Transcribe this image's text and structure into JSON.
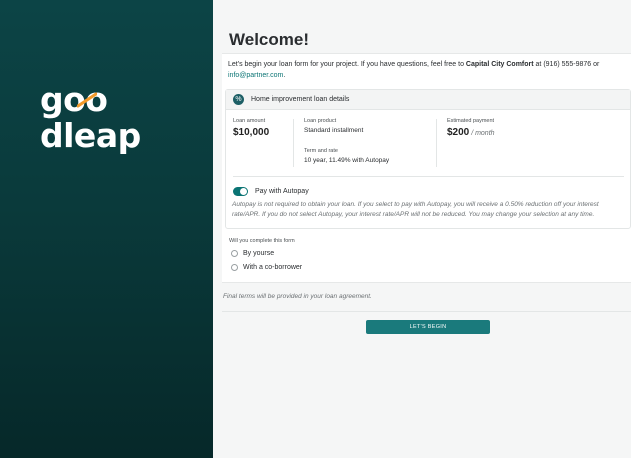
{
  "brand": {
    "logo_text_before": "g",
    "logo_text_oo": "oo",
    "logo_text_after": "dleap",
    "logo_name": "goodleap",
    "accent_color": "#f39a2a"
  },
  "main": {
    "title": "Welcome!",
    "intro": {
      "part1": "Let's begin your loan form for your project. If you have questions, feel free to ",
      "partner": "Capital City Comfort",
      "part2": " at (916) 555-9876 or ",
      "email": "info@partner.com",
      "part3": "."
    },
    "loan": {
      "header": "Home improvement loan details",
      "amount_label": "Loan amount",
      "amount_value": "$10,000",
      "product_label": "Loan product",
      "product_value": "Standard installment",
      "term_label": "Term and rate",
      "term_value": "10 year, 11.49% with Autopay",
      "payment_label": "Estimated payment",
      "payment_value": "$200",
      "payment_unit": " / month",
      "autopay_label": "Pay with Autopay",
      "autopay_enabled": true,
      "autopay_note": "Autopay is not required to obtain your loan. If you select to pay with Autopay, you will receive a 0.50% reduction off your interest rate/APR. If you do not select Autopay, your interest rate/APR will not be reduced. You may change your selection at any time."
    },
    "form": {
      "question": "Will you complete this form",
      "options": [
        "By yourse",
        "With a co-borrower"
      ]
    },
    "final_terms": "Final terms will be provided in your loan agreement.",
    "begin_label": "LET'S BEGIN"
  },
  "colors": {
    "sidebar": "#0a3a3b",
    "primary": "#1a7a7c",
    "toggle_on": "#0b7474"
  }
}
